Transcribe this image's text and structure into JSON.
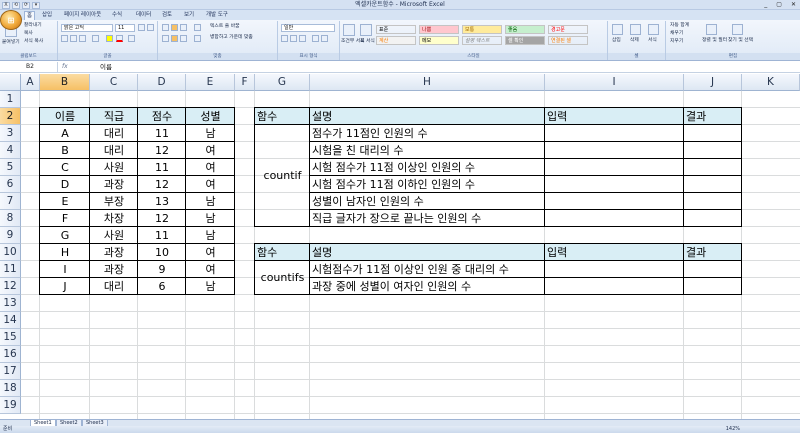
{
  "window": {
    "title": "엑셀카운트함수 - Microsoft Excel",
    "controls": [
      "_",
      "▢",
      "✕"
    ]
  },
  "qat": [
    "X",
    "⟲",
    "⟳",
    "▾"
  ],
  "ribbon_tabs": [
    "홈",
    "삽입",
    "페이지 레이아웃",
    "수식",
    "데이터",
    "검토",
    "보기",
    "개발 도구"
  ],
  "ribbon": {
    "clipboard": {
      "paste": "붙여넣기",
      "cut": "잘라내기",
      "copy": "복사",
      "format_painter": "서식 복사",
      "label": "클립보드"
    },
    "font": {
      "name": "맑은 고딕",
      "size": "11",
      "label": "글꼴"
    },
    "alignment": {
      "wrap": "텍스트 줄 바꿈",
      "merge": "병합하고 가운데 맞춤",
      "label": "맞춤"
    },
    "number": {
      "format": "일반",
      "label": "표시 형식"
    },
    "styles": {
      "conditional": "조건부 서식",
      "table": "표 서식",
      "cells": [
        {
          "text": "표준",
          "bg": "#ffffff",
          "fg": "#000000"
        },
        {
          "text": "나쁨",
          "bg": "#ffc7ce",
          "fg": "#9c0006"
        },
        {
          "text": "보통",
          "bg": "#ffeb9c",
          "fg": "#9c6500"
        },
        {
          "text": "좋음",
          "bg": "#c6efce",
          "fg": "#006100"
        },
        {
          "text": "경고문",
          "bg": "#ffffff",
          "fg": "#ff0000"
        },
        {
          "text": "계산",
          "bg": "#f2f2f2",
          "fg": "#fa7d00"
        },
        {
          "text": "메모",
          "bg": "#ffffcc",
          "fg": "#000000"
        },
        {
          "text": "설명 텍스트",
          "bg": "#ffffff",
          "fg": "#7f7f7f"
        },
        {
          "text": "셀 확인",
          "bg": "#a5a5a5",
          "fg": "#ffffff"
        },
        {
          "text": "연결된 셀",
          "bg": "#ffffff",
          "fg": "#fa7d00"
        }
      ],
      "label": "스타일"
    },
    "cells": {
      "insert": "삽입",
      "delete": "삭제",
      "format": "서식",
      "label": "셀"
    },
    "editing": {
      "autosum": "자동 합계",
      "fill": "채우기",
      "clear": "지우기",
      "sort": "정렬 및 필터",
      "find": "찾기 및 선택",
      "label": "편집"
    }
  },
  "formula_bar": {
    "name_box": "B2",
    "fx": "fx",
    "content": "이름"
  },
  "columns": [
    "A",
    "B",
    "C",
    "D",
    "E",
    "F",
    "G",
    "H",
    "I",
    "J",
    "K"
  ],
  "rows": [
    "1",
    "2",
    "3",
    "4",
    "5",
    "6",
    "7",
    "8",
    "9",
    "10",
    "11",
    "12",
    "13",
    "14",
    "15",
    "16",
    "17",
    "18",
    "19"
  ],
  "table1": {
    "headers": [
      "이름",
      "직급",
      "점수",
      "성별"
    ],
    "rows": [
      [
        "A",
        "대리",
        "11",
        "남"
      ],
      [
        "B",
        "대리",
        "12",
        "여"
      ],
      [
        "C",
        "사원",
        "11",
        "여"
      ],
      [
        "D",
        "과장",
        "12",
        "여"
      ],
      [
        "E",
        "부장",
        "13",
        "남"
      ],
      [
        "F",
        "차장",
        "12",
        "남"
      ],
      [
        "G",
        "사원",
        "11",
        "남"
      ],
      [
        "H",
        "과장",
        "10",
        "여"
      ],
      [
        "I",
        "과장",
        "9",
        "여"
      ],
      [
        "J",
        "대리",
        "6",
        "남"
      ]
    ]
  },
  "table2": {
    "headers": [
      "함수",
      "설명",
      "입력",
      "결과"
    ],
    "func": "countif",
    "rows": [
      "점수가 11점인 인원의 수",
      "시험을 친 대리의 수",
      "시험 점수가 11점 이상인 인원의 수",
      "시험 점수가 11점 이하인 인원의 수",
      "성별이 남자인 인원의 수",
      "직급 글자가 장으로 끝나는 인원의 수"
    ]
  },
  "table3": {
    "headers": [
      "함수",
      "설명",
      "입력",
      "결과"
    ],
    "func": "countifs",
    "rows": [
      "시험점수가 11점 이상인 인원 중 대리의 수",
      "과장 중에 성별이 여자인 인원의 수"
    ]
  },
  "sheets": [
    "Sheet1",
    "Sheet2",
    "Sheet3"
  ],
  "status": {
    "ready": "준비",
    "zoom": "142%"
  },
  "colors": {
    "header_fill": "#d9eef5",
    "selected_header": "#f6c065"
  }
}
